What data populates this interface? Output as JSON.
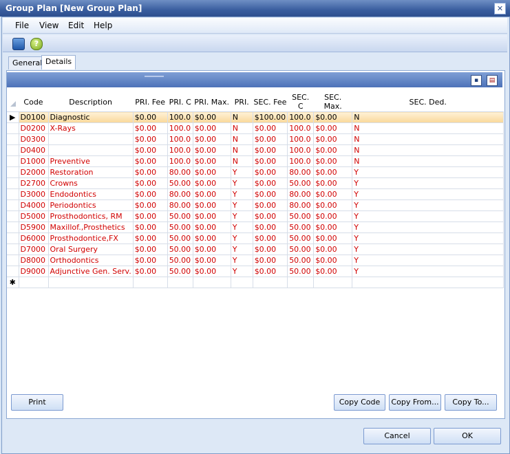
{
  "window": {
    "title": "Group Plan [New Group Plan]",
    "close_glyph": "✕"
  },
  "menu": {
    "file": "File",
    "view": "View",
    "edit": "Edit",
    "help": "Help"
  },
  "toolbar": {
    "exit_icon": "exit-icon",
    "help_icon": "help-icon"
  },
  "tabs": [
    {
      "label": "General"
    },
    {
      "label": "Details"
    }
  ],
  "grid": {
    "headers": [
      "Code",
      "Description",
      "PRI. Fee",
      "PRI. C",
      "PRI. Max.",
      "PRI.",
      "SEC. Fee",
      "SEC. C",
      "SEC. Max.",
      "SEC. Ded."
    ],
    "rows": [
      [
        "D0100",
        "Diagnostic",
        "$0.00",
        "100.0",
        "$0.00",
        "N",
        "$100.00",
        "100.0",
        "$0.00",
        "N"
      ],
      [
        "D0200",
        "X-Rays",
        "$0.00",
        "100.0",
        "$0.00",
        "N",
        "$0.00",
        "100.0",
        "$0.00",
        "N"
      ],
      [
        "D0300",
        "",
        "$0.00",
        "100.0",
        "$0.00",
        "N",
        "$0.00",
        "100.0",
        "$0.00",
        "N"
      ],
      [
        "D0400",
        "",
        "$0.00",
        "100.0",
        "$0.00",
        "N",
        "$0.00",
        "100.0",
        "$0.00",
        "N"
      ],
      [
        "D1000",
        "Preventive",
        "$0.00",
        "100.0",
        "$0.00",
        "N",
        "$0.00",
        "100.0",
        "$0.00",
        "N"
      ],
      [
        "D2000",
        "Restoration",
        "$0.00",
        "80.00",
        "$0.00",
        "Y",
        "$0.00",
        "80.00",
        "$0.00",
        "Y"
      ],
      [
        "D2700",
        "Crowns",
        "$0.00",
        "50.00",
        "$0.00",
        "Y",
        "$0.00",
        "50.00",
        "$0.00",
        "Y"
      ],
      [
        "D3000",
        "Endodontics",
        "$0.00",
        "80.00",
        "$0.00",
        "Y",
        "$0.00",
        "80.00",
        "$0.00",
        "Y"
      ],
      [
        "D4000",
        "Periodontics",
        "$0.00",
        "80.00",
        "$0.00",
        "Y",
        "$0.00",
        "80.00",
        "$0.00",
        "Y"
      ],
      [
        "D5000",
        "Prosthodontics, RM",
        "$0.00",
        "50.00",
        "$0.00",
        "Y",
        "$0.00",
        "50.00",
        "$0.00",
        "Y"
      ],
      [
        "D5900",
        "Maxillof.,Prosthetics",
        "$0.00",
        "50.00",
        "$0.00",
        "Y",
        "$0.00",
        "50.00",
        "$0.00",
        "Y"
      ],
      [
        "D6000",
        "Prosthodontice,FX",
        "$0.00",
        "50.00",
        "$0.00",
        "Y",
        "$0.00",
        "50.00",
        "$0.00",
        "Y"
      ],
      [
        "D7000",
        "Oral Surgery",
        "$0.00",
        "50.00",
        "$0.00",
        "Y",
        "$0.00",
        "50.00",
        "$0.00",
        "Y"
      ],
      [
        "D8000",
        "Orthodontics",
        "$0.00",
        "50.00",
        "$0.00",
        "Y",
        "$0.00",
        "50.00",
        "$0.00",
        "Y"
      ],
      [
        "D9000",
        "Adjunctive Gen. Serv.",
        "$0.00",
        "50.00",
        "$0.00",
        "Y",
        "$0.00",
        "50.00",
        "$0.00",
        "Y"
      ]
    ],
    "new_row_marker": "✱",
    "current_row_marker": "▶"
  },
  "buttons": {
    "print": "Print",
    "copy_code": "Copy Code",
    "copy_from": "Copy From...",
    "copy_to": "Copy To...",
    "cancel": "Cancel",
    "ok": "OK"
  }
}
